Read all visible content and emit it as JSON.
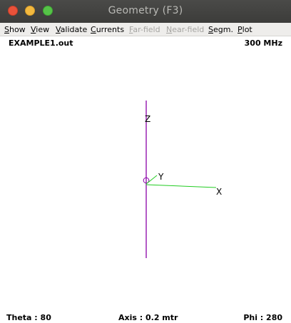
{
  "window": {
    "title": "Geometry  (F3)"
  },
  "menu": [
    {
      "mn": "S",
      "rest": "how",
      "enabled": true
    },
    {
      "mn": "V",
      "rest": "iew",
      "enabled": true
    },
    {
      "mn": "V",
      "rest": "alidate",
      "enabled": true
    },
    {
      "mn": "C",
      "rest": "urrents",
      "enabled": true
    },
    {
      "mn": "F",
      "rest": "ar-field",
      "enabled": false
    },
    {
      "mn": "N",
      "rest": "ear-field",
      "enabled": false
    },
    {
      "mn": "S",
      "rest": "egm.",
      "enabled": true
    },
    {
      "mn": "P",
      "rest": "lot",
      "enabled": true
    }
  ],
  "header": {
    "filename": "EXAMPLE1.out",
    "frequency": "300 MHz"
  },
  "plot": {
    "axis_labels": {
      "z": "Z",
      "y": "Y",
      "x": "X"
    },
    "colors": {
      "wire": "#8a00a8",
      "axes": "#22cc22",
      "origin": "#8a00a8"
    }
  },
  "footer": {
    "theta": "Theta : 80",
    "axis": "Axis : 0.2 mtr",
    "phi": "Phi : 280"
  }
}
